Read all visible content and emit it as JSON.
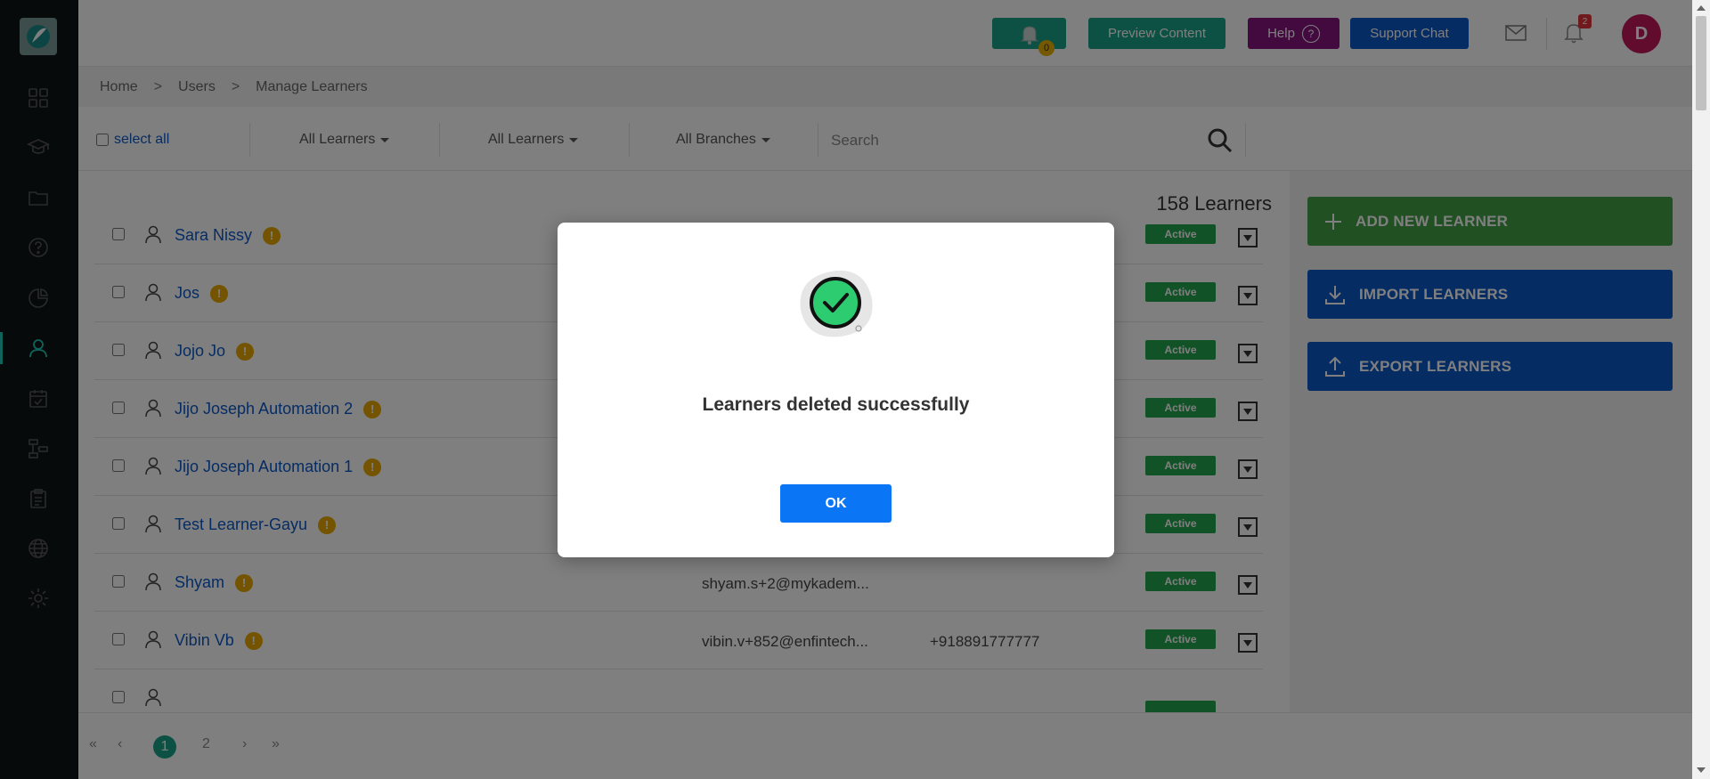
{
  "topbar": {
    "bell_badge": "0",
    "preview_label": "Preview Content",
    "help_label": "Help",
    "help_icon_glyph": "?",
    "support_label": "Support Chat",
    "notification_count": "2",
    "avatar_initial": "D"
  },
  "breadcrumb": {
    "items": [
      "Home",
      "Users",
      "Manage Learners"
    ],
    "separator": ">"
  },
  "filters": {
    "select_all_label": "select all",
    "dropdown1": "All Learners",
    "dropdown2": "All Learners",
    "dropdown3": "All Branches",
    "search_placeholder": "Search"
  },
  "learners": {
    "count_label": "158 Learners",
    "rows": [
      {
        "name": "Sara Nissy",
        "email": "",
        "phone": "",
        "status": "Active"
      },
      {
        "name": "Jos",
        "email": "",
        "phone": "",
        "status": "Active"
      },
      {
        "name": "Jojo Jo",
        "email": "",
        "phone": "",
        "status": "Active"
      },
      {
        "name": "Jijo Joseph Automation 2",
        "email": "",
        "phone": "",
        "status": "Active"
      },
      {
        "name": "Jijo Joseph Automation 1",
        "email": "",
        "phone": "",
        "status": "Active"
      },
      {
        "name": "Test Learner-Gayu",
        "email": "",
        "phone": "",
        "status": "Active"
      },
      {
        "name": "Shyam",
        "email": "shyam.s+2@mykadem...",
        "phone": "",
        "status": "Active"
      },
      {
        "name": "Vibin Vb",
        "email": "vibin.v+852@enfintech...",
        "phone": "+918891777777",
        "status": "Active"
      },
      {
        "name": "",
        "email": "",
        "phone": "",
        "status": ""
      }
    ],
    "warn_glyph": "!"
  },
  "right_panel": {
    "add_label": "ADD NEW LEARNER",
    "import_label": "IMPORT LEARNERS",
    "export_label": "EXPORT LEARNERS"
  },
  "pagination": {
    "first": "«",
    "prev": "‹",
    "pages": [
      "1",
      "2"
    ],
    "current": "1",
    "next": "›",
    "last": "»"
  },
  "modal": {
    "message": "Learners deleted successfully",
    "ok_label": "OK"
  },
  "colors": {
    "teal": "#1ba388",
    "purple": "#84157f",
    "blue": "#0d58c8",
    "green": "#43a047",
    "status_green": "#23a74f",
    "avatar": "#c2185b",
    "sidebar": "#0f1516"
  },
  "icons": {
    "sidebar": [
      "dashboard-icon",
      "graduation-cap-icon",
      "folder-icon",
      "help-circle-icon",
      "pie-chart-icon",
      "learners-icon",
      "calendar-icon",
      "sitemap-icon",
      "clipboard-icon",
      "globe-icon",
      "settings-icon"
    ]
  }
}
